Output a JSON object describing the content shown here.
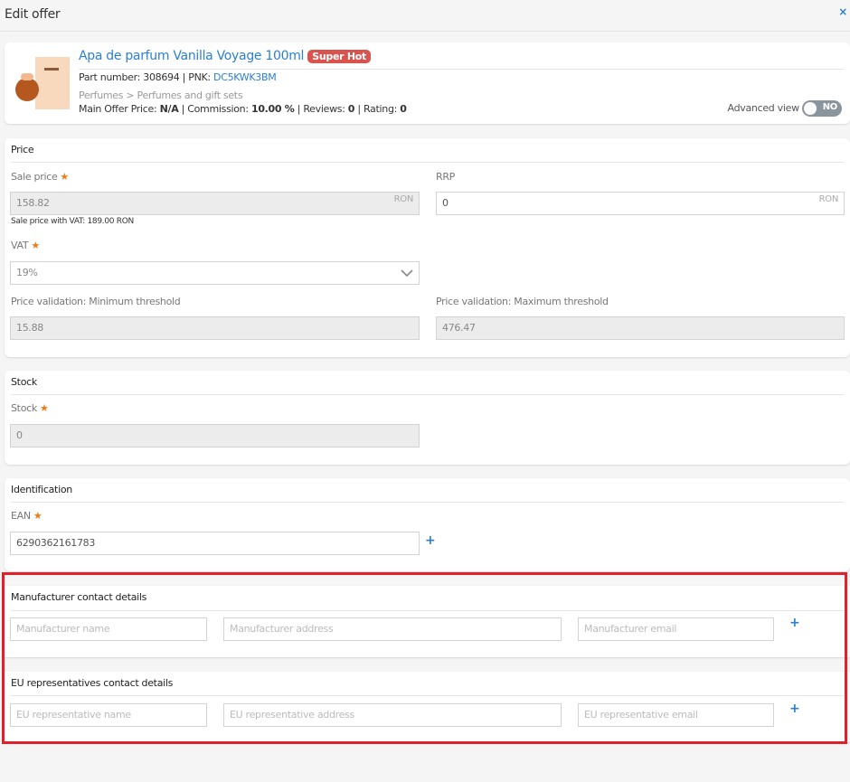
{
  "header": {
    "title": "Edit offer",
    "close": "×"
  },
  "product": {
    "title": "Apa de parfum Vanilla Voyage 100ml",
    "badge": "Super Hot",
    "part_label": "Part number: 308694 | PNK: ",
    "pnk": "DC5KWK3BM",
    "category": "Perfumes > Perfumes and gift sets",
    "main_price_label": "Main Offer Price: ",
    "main_price": "N/A",
    "commission_label": " | Commission: ",
    "commission": "10.00 %",
    "reviews_label": " | Reviews: ",
    "reviews": "0",
    "rating_label": " | Rating: ",
    "rating": "0",
    "advanced_label": "Advanced view",
    "advanced_value": "NO"
  },
  "price": {
    "title": "Price",
    "sale_label": "Sale price",
    "sale_value": "158.82",
    "currency": "RON",
    "vat_hint": "Sale price with VAT: 189.00 RON",
    "rrp_label": "RRP",
    "rrp_value": "0",
    "vat_label": "VAT",
    "vat_value": "19%",
    "min_label": "Price validation: Minimum threshold",
    "min_value": "15.88",
    "max_label": "Price validation: Maximum threshold",
    "max_value": "476.47"
  },
  "stock": {
    "title": "Stock",
    "label": "Stock",
    "value": "0"
  },
  "identification": {
    "title": "Identification",
    "label": "EAN",
    "value": "6290362161783",
    "add": "+"
  },
  "manufacturer": {
    "title": "Manufacturer contact details",
    "name_ph": "Manufacturer name",
    "address_ph": "Manufacturer address",
    "email_ph": "Manufacturer email",
    "add": "+"
  },
  "eu": {
    "title": "EU representatives contact details",
    "name_ph": "EU representative name",
    "address_ph": "EU representative address",
    "email_ph": "EU representative email",
    "add": "+"
  }
}
